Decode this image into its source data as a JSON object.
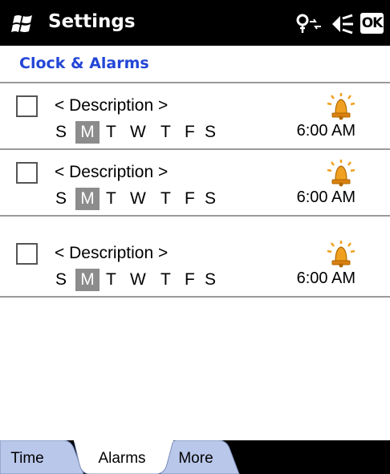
{
  "titlebar": {
    "app_title": "Settings",
    "ok_label": "OK",
    "start_icon": "windows-flag-icon",
    "connectivity_icon": "connectivity-icon",
    "volume_icon": "volume-icon"
  },
  "page": {
    "title": "Clock & Alarms"
  },
  "alarms": [
    {
      "description": "< Description >",
      "days": [
        "S",
        "M",
        "T",
        "W",
        "T",
        "F",
        "S"
      ],
      "active_day": "M",
      "time": "6:00 AM",
      "enabled": false
    },
    {
      "description": "< Description >",
      "days": [
        "S",
        "M",
        "T",
        "W",
        "T",
        "F",
        "S"
      ],
      "active_day": "M",
      "time": "6:00 AM",
      "enabled": false
    },
    {
      "description": "< Description >",
      "days": [
        "S",
        "M",
        "T",
        "W",
        "T",
        "F",
        "S"
      ],
      "active_day": "M",
      "time": "6:00 AM",
      "enabled": false
    }
  ],
  "tabs": [
    {
      "label": "Time",
      "selected": false
    },
    {
      "label": "Alarms",
      "selected": true
    },
    {
      "label": "More",
      "selected": false
    }
  ],
  "colors": {
    "title_accent": "#2346d6",
    "tab_inactive": "#b9c7ea",
    "day_highlight": "#8c8c8c",
    "bell": "#f0a020"
  }
}
